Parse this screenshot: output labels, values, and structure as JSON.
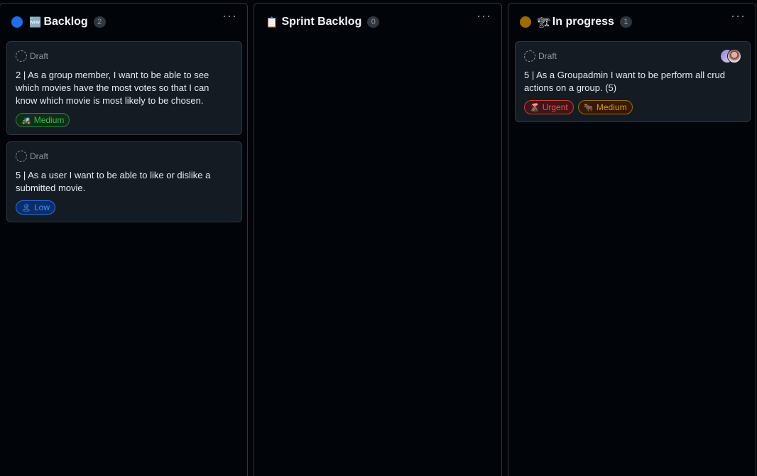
{
  "columns": [
    {
      "title": "Backlog",
      "emoji": "🆕",
      "count": "2",
      "dot_color": "#1f6feb",
      "more": "···",
      "cards": [
        {
          "draft": "Draft",
          "title": "2 | As a group member, I want to be able to see which movies have the most votes so that I can know which movie is most likely to be chosen.",
          "labels": [
            {
              "emoji": "🚜",
              "text": "Medium",
              "color": "#3fb950",
              "border": "#238636",
              "bg": "#0f2d1a"
            }
          ]
        },
        {
          "draft": "Draft",
          "title": "5 | As a user I want to be able to like or dislike a submitted movie.",
          "labels": [
            {
              "emoji": "🏝",
              "text": "Low",
              "color": "#4493f8",
              "border": "#1f6feb",
              "bg": "#0c2d6b"
            }
          ]
        }
      ]
    },
    {
      "title": "Sprint Backlog",
      "emoji": "📋",
      "count": "0",
      "more": "···",
      "cards": []
    },
    {
      "title": "In progress",
      "emoji": "🏗",
      "count": "1",
      "dot_color": "#9e6a03",
      "more": "···",
      "cards": [
        {
          "draft": "Draft",
          "title": "5 | As a Groupadmin I want to be perform all crud actions on a group. (5)",
          "has_avatar": true,
          "labels": [
            {
              "emoji": "🌋",
              "text": "Urgent",
              "color": "#f85149",
              "border": "#da3633",
              "bg": "#3c1618"
            },
            {
              "emoji": "🐂",
              "text": "Medium",
              "color": "#d29922",
              "border": "#9e6a03",
              "bg": "#341a04"
            }
          ]
        }
      ]
    }
  ]
}
